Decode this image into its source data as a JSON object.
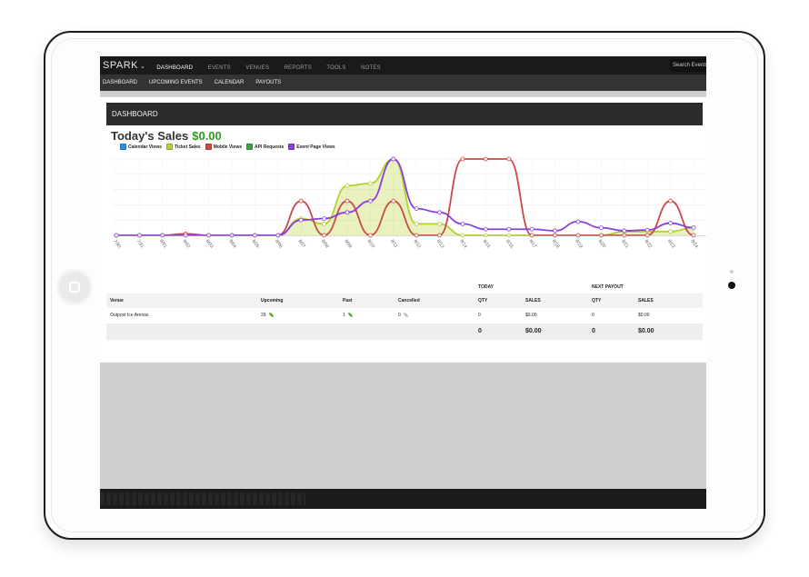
{
  "app": {
    "brand": "SPARK",
    "nav": [
      "DASHBOARD",
      "EVENTS",
      "VENUES",
      "REPORTS",
      "TOOLS",
      "NOTES"
    ],
    "active_nav": "DASHBOARD",
    "search_placeholder": "Search Events",
    "subnav": [
      "DASHBOARD",
      "UPCOMING EVENTS",
      "CALENDAR",
      "PAYOUTS"
    ]
  },
  "dashboard": {
    "header": "DASHBOARD",
    "sales_label": "Today's Sales",
    "sales_amount": "$0.00"
  },
  "chart_data": {
    "type": "line",
    "x": [
      "7/30",
      "7/31",
      "8/01",
      "8/02",
      "8/03",
      "8/04",
      "8/05",
      "8/06",
      "8/07",
      "8/08",
      "8/09",
      "8/10",
      "8/11",
      "8/12",
      "8/13",
      "8/14",
      "8/15",
      "8/16",
      "8/17",
      "8/18",
      "8/19",
      "8/20",
      "8/21",
      "8/22",
      "8/23",
      "8/24"
    ],
    "series": [
      {
        "name": "Calendar Views",
        "color": "#2f8fd8",
        "values": []
      },
      {
        "name": "Ticket Sales",
        "color": "#b5cf2f",
        "values": [
          0,
          0,
          0,
          0,
          0,
          0,
          0,
          0,
          22,
          15,
          65,
          68,
          100,
          15,
          15,
          0,
          0,
          0,
          0,
          0,
          0,
          0,
          5,
          5,
          5,
          10
        ]
      },
      {
        "name": "Mobile Views",
        "color": "#c94a46",
        "values": [
          0,
          0,
          0,
          2,
          0,
          0,
          0,
          0,
          45,
          0,
          45,
          0,
          45,
          0,
          0,
          100,
          100,
          100,
          0,
          0,
          0,
          0,
          0,
          0,
          45,
          0
        ]
      },
      {
        "name": "API Requests",
        "color": "#3ea14a",
        "values": []
      },
      {
        "name": "Event Page Views",
        "color": "#8c3fe0",
        "values": [
          0,
          0,
          0,
          0,
          0,
          0,
          0,
          0,
          20,
          22,
          30,
          45,
          100,
          35,
          30,
          15,
          8,
          8,
          8,
          6,
          18,
          10,
          6,
          7,
          16,
          10
        ]
      }
    ]
  },
  "table": {
    "groups": {
      "today": "TODAY",
      "next_payout": "NEXT PAYOUT"
    },
    "headers": {
      "venue": "Venue",
      "upcoming": "Upcoming",
      "past": "Past",
      "cancelled": "Cancelled",
      "qty": "QTY",
      "sales": "SALES"
    },
    "rows": [
      {
        "venue": "Outpost Ice Arenas",
        "upcoming": "29",
        "past": "1",
        "cancelled": "0",
        "today_qty": "0",
        "today_sales": "$0.00",
        "payout_qty": "0",
        "payout_sales": "$0.00"
      }
    ],
    "totals": {
      "today_qty": "0",
      "today_sales": "$0.00",
      "payout_qty": "0",
      "payout_sales": "$0.00"
    }
  }
}
